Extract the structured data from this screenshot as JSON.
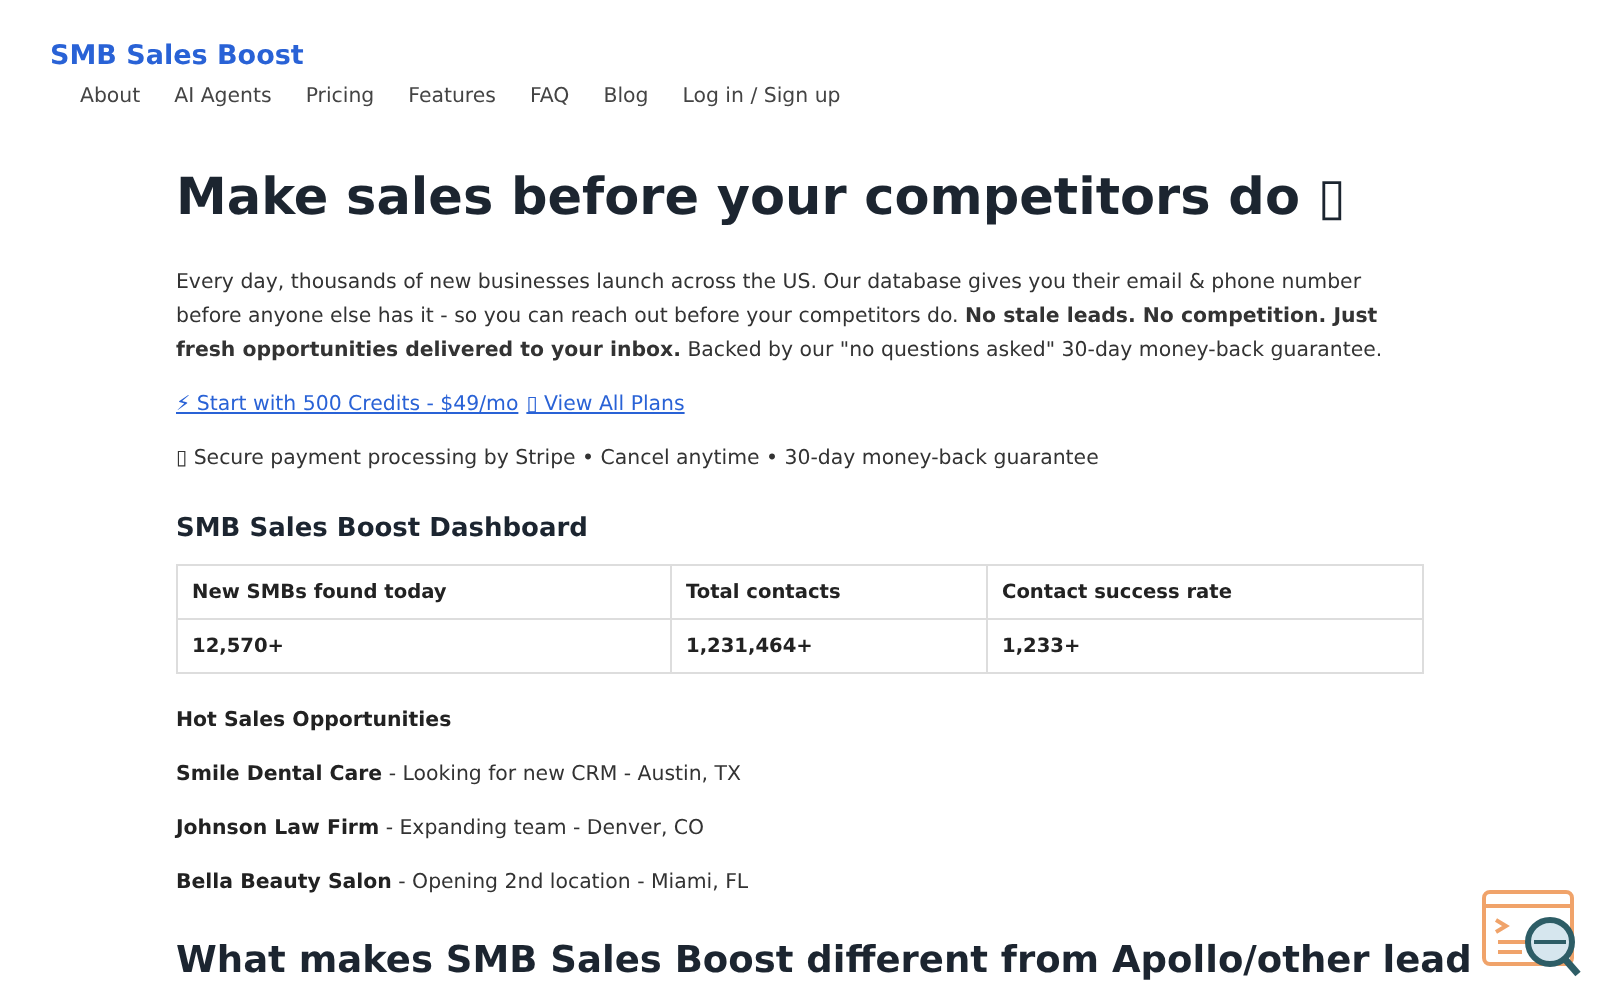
{
  "brand": "SMB Sales Boost",
  "nav": [
    "About",
    "AI Agents",
    "Pricing",
    "Features",
    "FAQ",
    "Blog",
    "Log in / Sign up"
  ],
  "headline": "Make sales before your competitors do ▯",
  "intro": "Every day, thousands of new businesses launch across the US. Our database gives you their email & phone number before anyone else has it - so you can reach out before your competitors do. **No stale leads. No competition. Just fresh opportunities delivered to your inbox.** Backed by our \"no questions asked\" 30-day money-back guarantee.",
  "links": [
    "⚡ Start with 500 Credits - $49/mo",
    "▯ View All Plans"
  ],
  "assurance": "▯ Secure payment processing by Stripe • Cancel anytime • 30-day money-back guarantee",
  "dashboard": {
    "title": "SMB Sales Boost Dashboard",
    "columns": [
      "New SMBs found today",
      "Total contacts",
      "Contact success rate"
    ],
    "rows": [
      [
        "12,570+",
        "1,231,464+",
        "1,233+"
      ]
    ]
  },
  "opportunities": {
    "title": "Hot Sales Opportunities",
    "items": [
      "**Smile Dental Care** - Looking for new CRM - Austin, TX",
      "**Johnson Law Firm** - Expanding team - Denver, CO",
      "**Bella Beauty Salon** - Opening 2nd location - Miami, FL"
    ]
  },
  "next_heading": "What makes SMB Sales Boost different from Apollo/other lead"
}
